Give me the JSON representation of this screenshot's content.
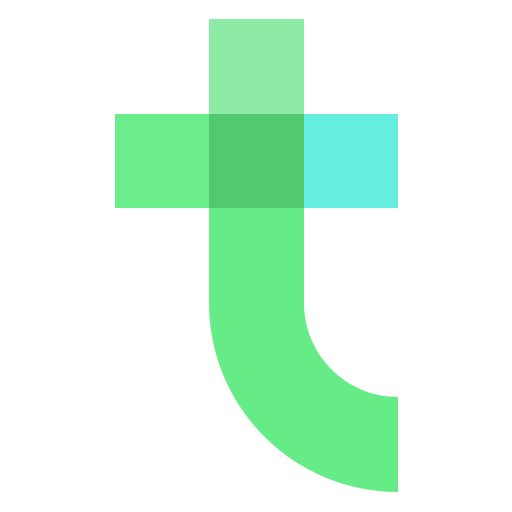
{
  "logo": {
    "icon": "letter-t-logo-icon",
    "colors": {
      "background": "#ffffff",
      "stem_top": "#8EEBA6",
      "crossbar_left": "#6AED8A",
      "crossbar_center": "#52C86F",
      "crossbar_right": "#63EEDF",
      "stem_body": "#66EC87"
    }
  }
}
